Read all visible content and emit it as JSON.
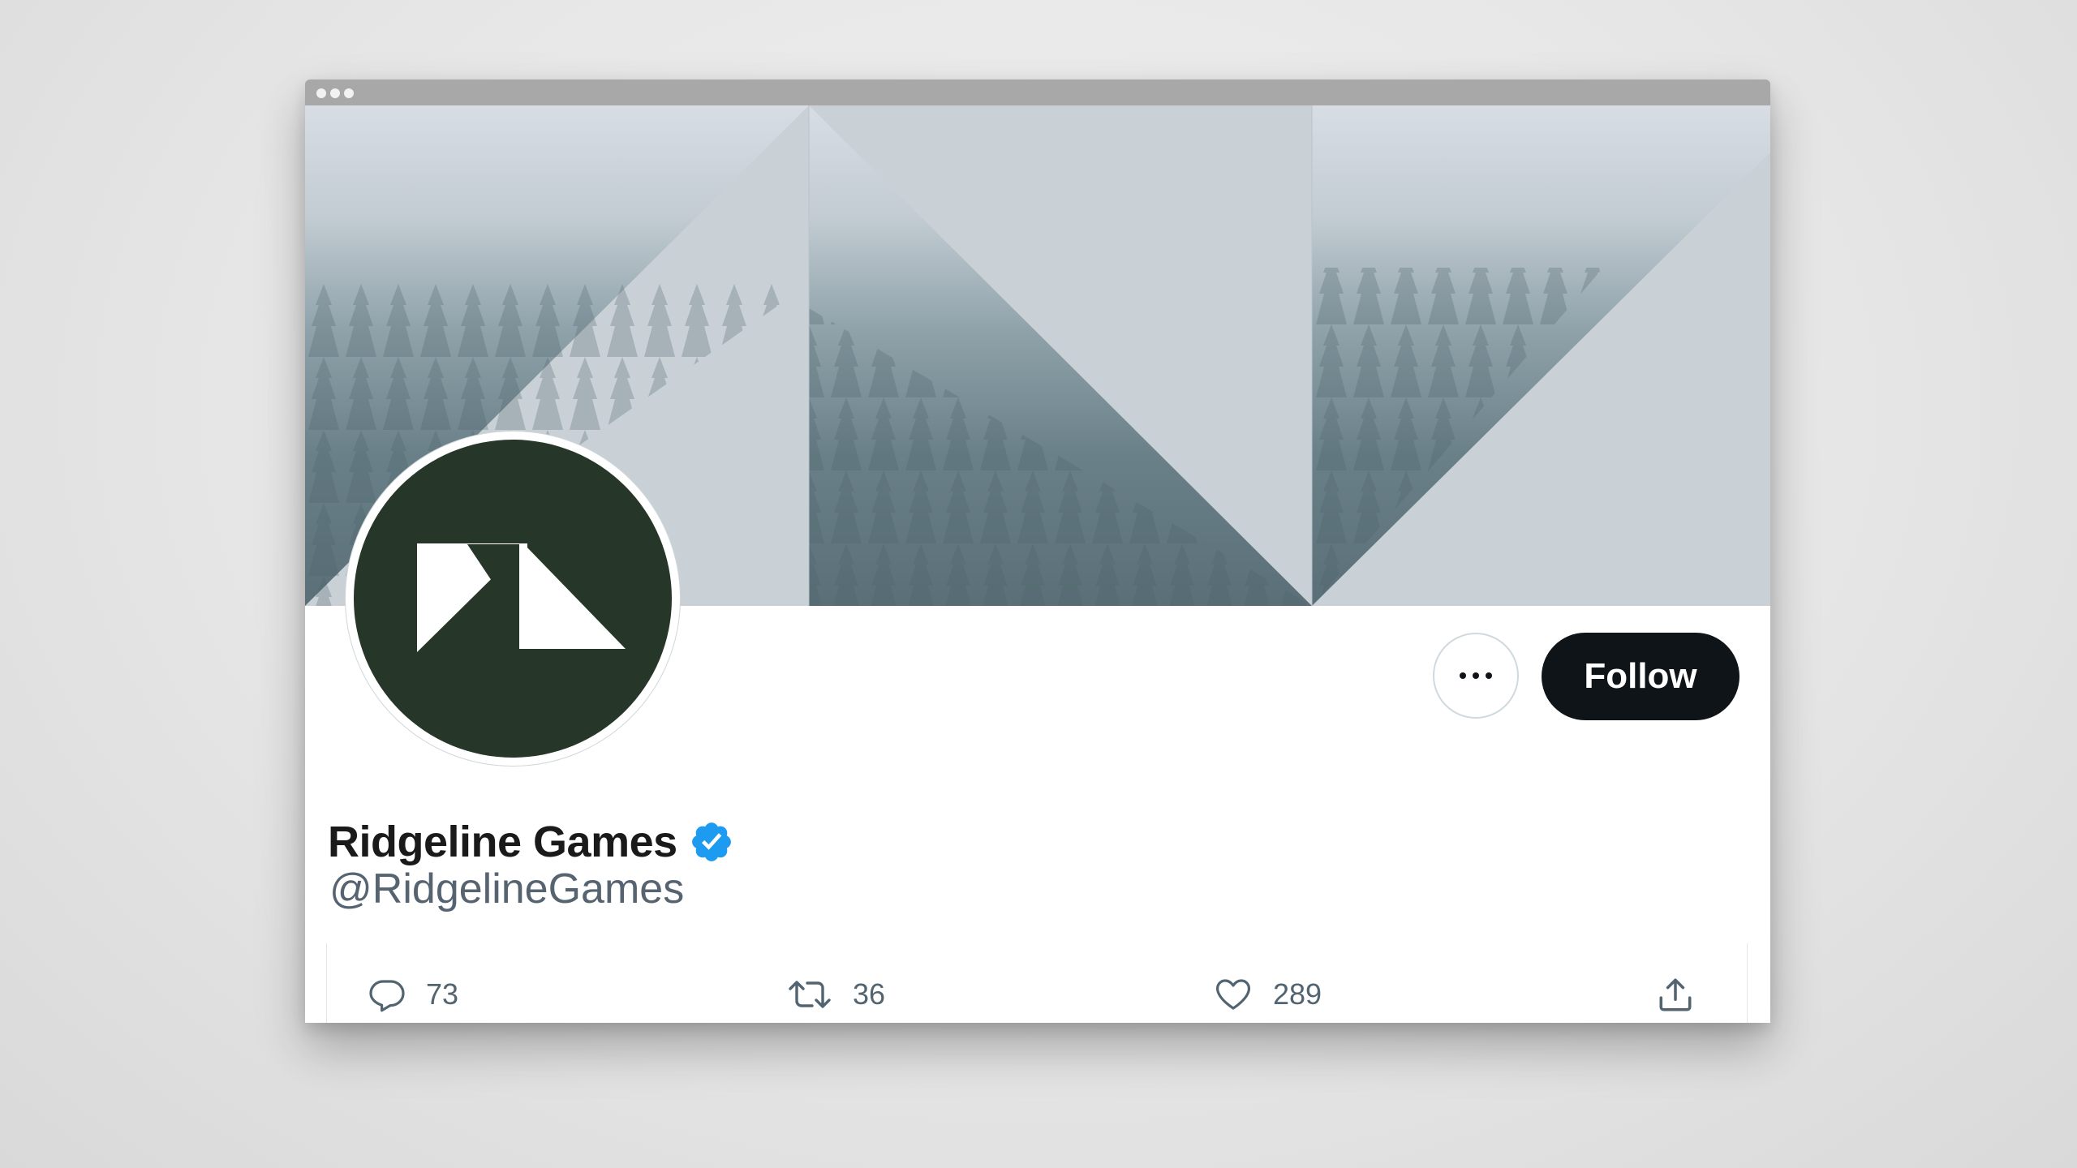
{
  "profile": {
    "display_name": "Ridgeline Games",
    "handle": "@RidgelineGames",
    "verified": true
  },
  "header_actions": {
    "more_icon": "more-horizontal-icon",
    "follow_label": "Follow"
  },
  "tweet_actions": {
    "reply": {
      "icon": "reply-icon",
      "count": "73"
    },
    "retweet": {
      "icon": "retweet-icon",
      "count": "36"
    },
    "like": {
      "icon": "heart-icon",
      "count": "289"
    },
    "share": {
      "icon": "share-icon"
    }
  },
  "colors": {
    "follow_button": "#0f1419",
    "verified_badge": "#1d9bf0",
    "avatar_background": "#263628",
    "banner_panel": "#c9d1d7",
    "forest": "#5e7680"
  }
}
